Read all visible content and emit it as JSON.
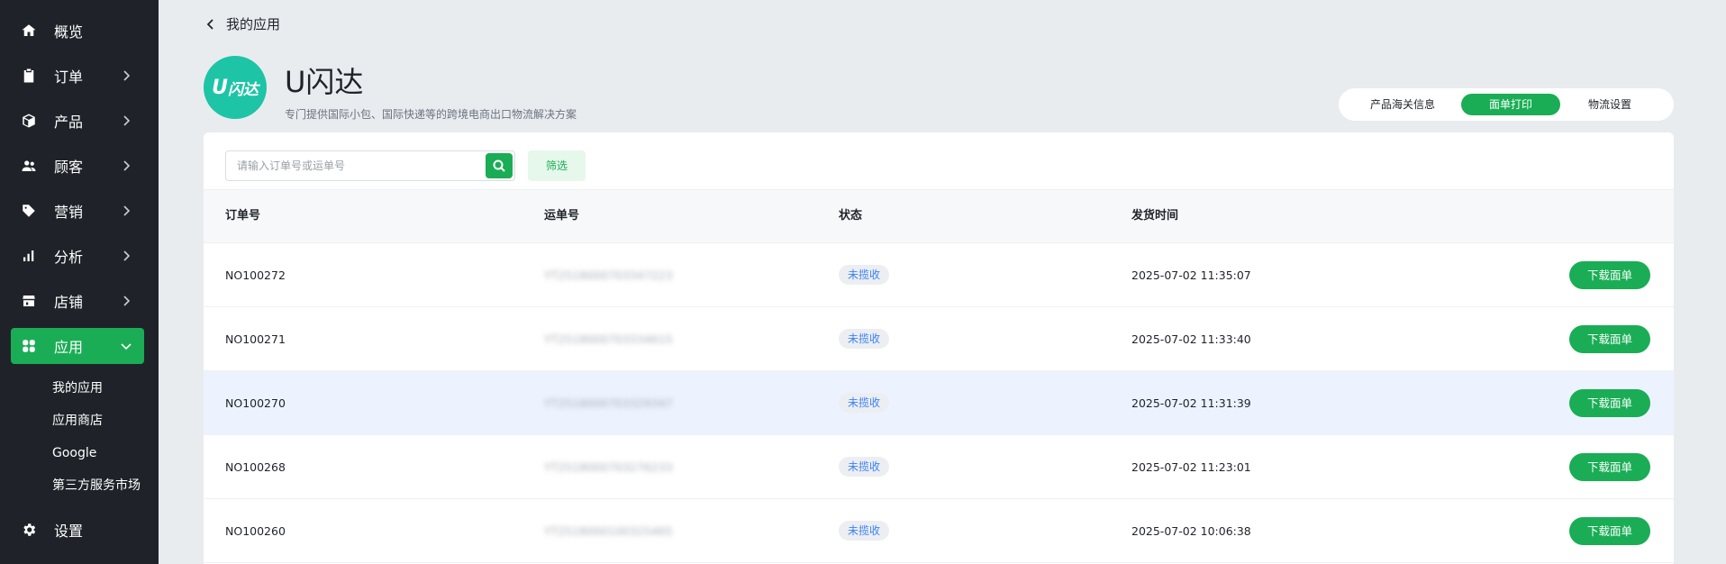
{
  "sidebar": {
    "items": [
      {
        "label": "概览",
        "icon": "home-icon"
      },
      {
        "label": "订单",
        "icon": "clipboard-icon"
      },
      {
        "label": "产品",
        "icon": "box-icon"
      },
      {
        "label": "顾客",
        "icon": "users-icon"
      },
      {
        "label": "营销",
        "icon": "tag-icon"
      },
      {
        "label": "分析",
        "icon": "bar-chart-icon"
      },
      {
        "label": "店铺",
        "icon": "store-icon"
      },
      {
        "label": "应用",
        "icon": "apps-icon"
      },
      {
        "label": "设置",
        "icon": "gear-icon"
      }
    ],
    "subitems": [
      "我的应用",
      "应用商店",
      "Google",
      "第三方服务市场"
    ],
    "active_color": "#1aad55"
  },
  "header": {
    "back_label": "我的应用",
    "app_name": "U闪达",
    "app_logo_text": "闪达",
    "app_logo_letter": "U",
    "app_desc": "专门提供国际小包、国际快递等的跨境电商出口物流解决方案"
  },
  "tabs": [
    {
      "label": "产品海关信息",
      "active": false
    },
    {
      "label": "面单打印",
      "active": true
    },
    {
      "label": "物流设置",
      "active": false
    }
  ],
  "search": {
    "placeholder": "请输入订单号或运单号",
    "filter_label": "筛选"
  },
  "table": {
    "columns": [
      "订单号",
      "运单号",
      "状态",
      "发货时间"
    ],
    "action_label": "下载面单",
    "rows": [
      {
        "order": "NO100272",
        "waybill": "YT2518000703347223",
        "status": "未揽收",
        "time": "2025-07-02 11:35:07"
      },
      {
        "order": "NO100271",
        "waybill": "YT2518000703334615",
        "status": "未揽收",
        "time": "2025-07-02 11:33:40"
      },
      {
        "order": "NO100270",
        "waybill": "YT2518000703329347",
        "status": "未揽收",
        "time": "2025-07-02 11:31:39"
      },
      {
        "order": "NO100268",
        "waybill": "YT2518000703276233",
        "status": "未揽收",
        "time": "2025-07-02 11:23:01"
      },
      {
        "order": "NO100260",
        "waybill": "YT2518000100325465",
        "status": "未揽收",
        "time": "2025-07-02 10:06:38"
      }
    ]
  }
}
